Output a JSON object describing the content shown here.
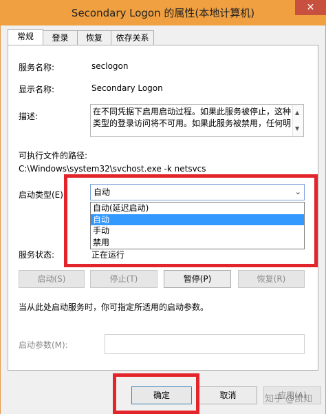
{
  "window": {
    "title": "Secondary Logon 的属性(本地计算机)",
    "close_glyph": "✕"
  },
  "tabs": [
    "常规",
    "登录",
    "恢复",
    "依存关系"
  ],
  "general": {
    "service_name_label": "服务名称:",
    "service_name": "seclogon",
    "display_name_label": "显示名称:",
    "display_name": "Secondary Logon",
    "description_label": "描述:",
    "description": "在不同凭据下启用启动过程。如果此服务被停止，这种类型的登录访问将不可用。如果此服务被禁用，任何明",
    "path_label": "可执行文件的路径:",
    "path": "C:\\Windows\\system32\\svchost.exe -k netsvcs",
    "startup_type_label": "启动类型(E):",
    "startup_type_value": "自动",
    "startup_options": [
      "自动(延迟启动)",
      "自动",
      "手动",
      "禁用"
    ],
    "status_label": "服务状态:",
    "status_value": "正在运行",
    "buttons": {
      "start": "启动(S)",
      "stop": "停止(T)",
      "pause": "暂停(P)",
      "resume": "恢复(R)"
    },
    "hint": "当从此处启动服务时，你可指定所适用的启动参数。",
    "params_label": "启动参数(M):"
  },
  "footer": {
    "ok": "确定",
    "cancel": "取消",
    "apply": "应用(A)"
  },
  "watermark": "知乎 @凯知",
  "colors": {
    "highlight": "#e3252b",
    "selection": "#3399ff",
    "titlebar": "#f0a040"
  }
}
